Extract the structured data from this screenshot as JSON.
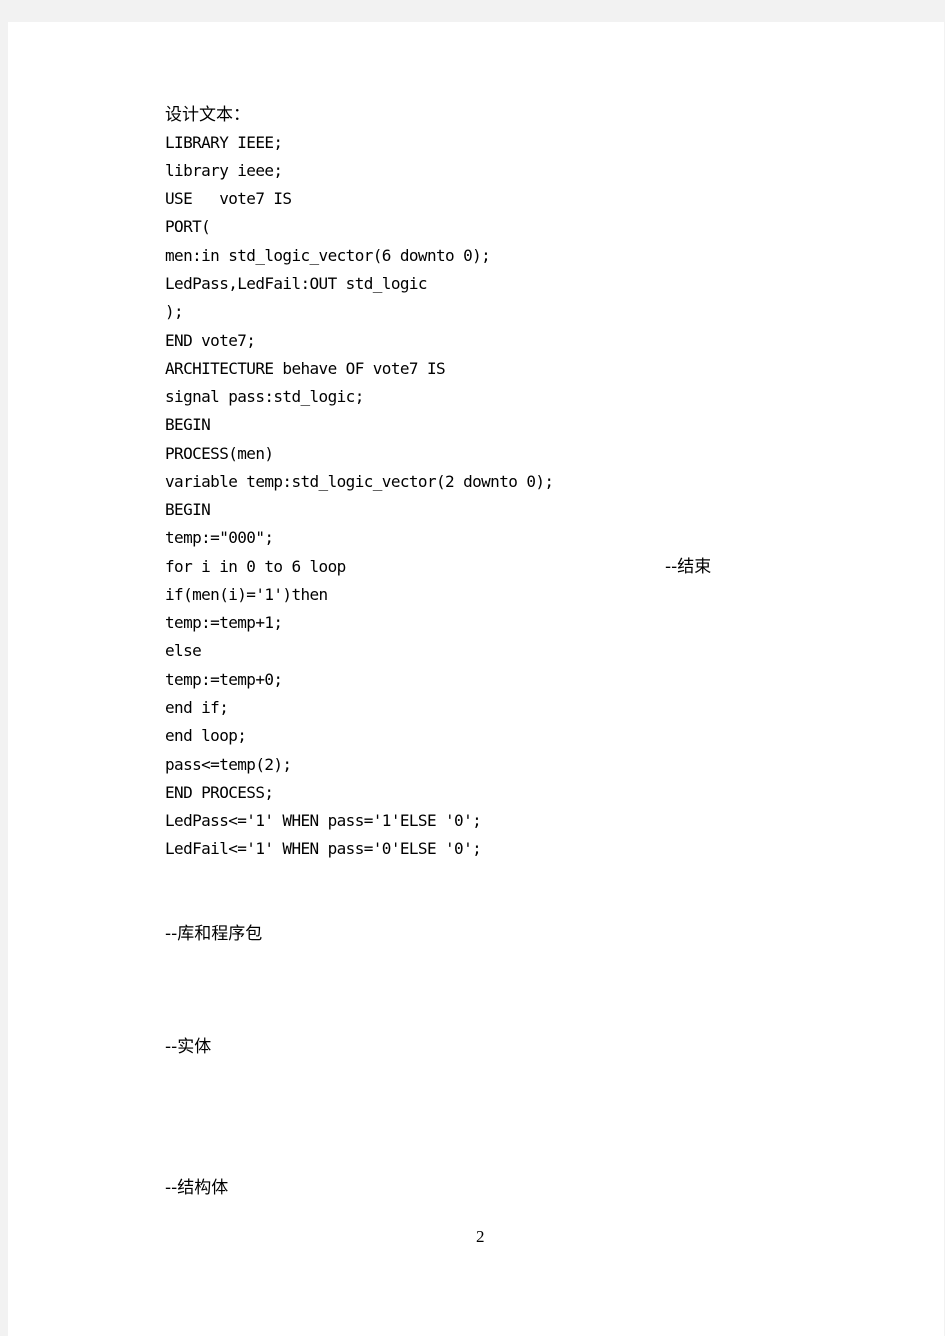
{
  "document": {
    "heading": "设计文本：",
    "code_lines": [
      "LIBRARY IEEE;",
      "library ieee;",
      "USE   vote7 IS",
      "PORT(",
      "men:in std_logic_vector(6 downto 0);",
      "LedPass,LedFail:OUT std_logic",
      ");",
      "END vote7;",
      "ARCHITECTURE behave OF vote7 IS",
      "signal pass:std_logic;",
      "BEGIN",
      "PROCESS(men)",
      "variable temp:std_logic_vector(2 downto 0);",
      "BEGIN",
      "temp:=\"000\";",
      "for i in 0 to 6 loop",
      "if(men(i)='1')then",
      "temp:=temp+1;",
      "else",
      "temp:=temp+0;",
      "end if;",
      "end loop;",
      "pass<=temp(2);",
      "END PROCESS;",
      "LedPass<='1' WHEN pass='1'ELSE '0';",
      "LedFail<='1' WHEN pass='0'ELSE '0';"
    ],
    "inline_comment": "--结束",
    "comments": {
      "library": "--库和程序包",
      "entity": "--实体",
      "architecture": "--结构体"
    },
    "page_number": "2"
  }
}
